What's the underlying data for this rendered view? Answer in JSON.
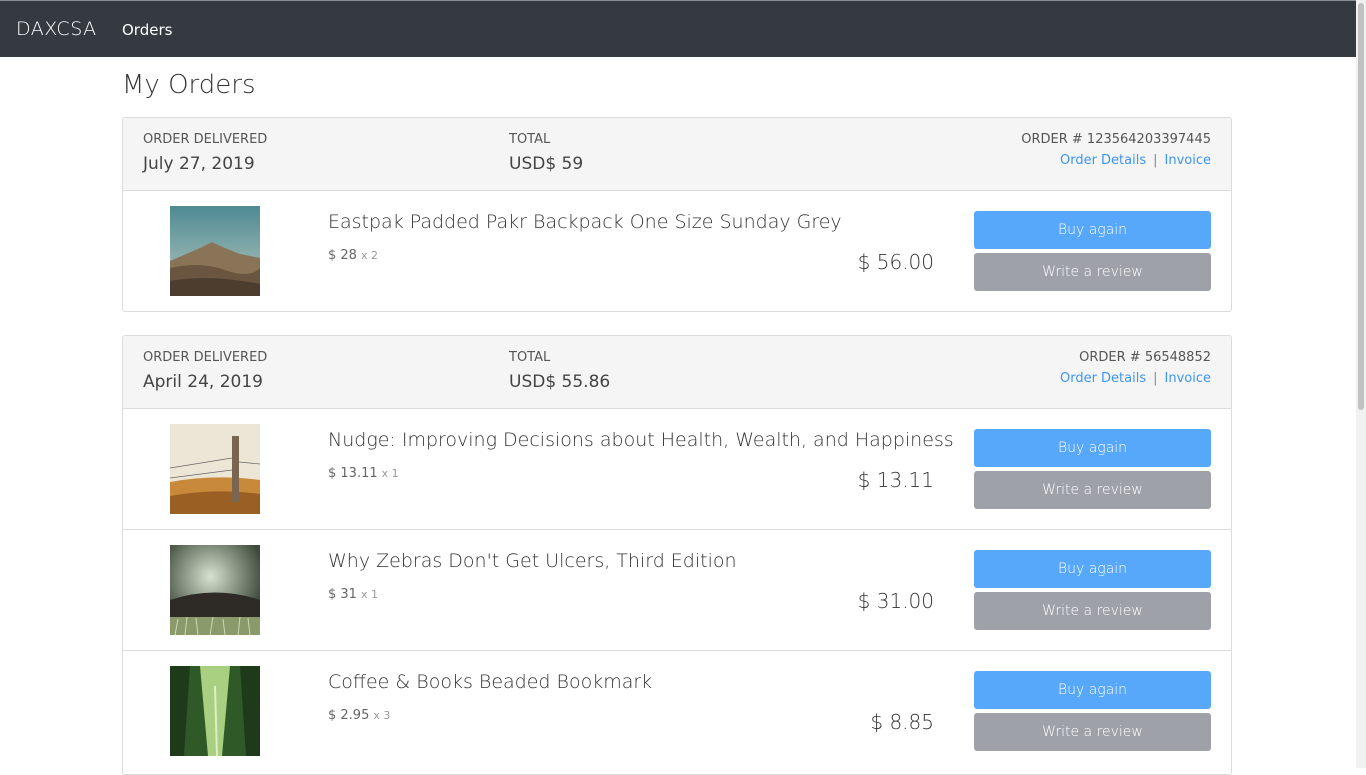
{
  "navbar": {
    "brand": "DAXCSA",
    "link": "Orders"
  },
  "page": {
    "title": "My Orders"
  },
  "labels": {
    "delivered": "ORDER DELIVERED",
    "total": "TOTAL",
    "order_details": "Order Details",
    "invoice": "Invoice",
    "separator": "|",
    "buy_again": "Buy again",
    "write_review": "Write a review"
  },
  "orders": [
    {
      "delivered_date": "July 27, 2019",
      "total": "USD$ 59",
      "order_number": "ORDER # 123564203397445",
      "items": [
        {
          "title": "Eastpak Padded Pakr Backpack One Size Sunday Grey",
          "unit_price": "$ 28",
          "qty": "x 2",
          "line_total": "$ 56.00",
          "image_icon": "mountain-landscape"
        }
      ]
    },
    {
      "delivered_date": "April 24, 2019",
      "total": "USD$ 55.86",
      "order_number": "ORDER # 56548852",
      "items": [
        {
          "title": "Nudge: Improving Decisions about Health, Wealth, and Happiness",
          "unit_price": "$ 13.11",
          "qty": "x 1",
          "line_total": "$ 13.11",
          "image_icon": "fence-post-field"
        },
        {
          "title": "Why Zebras Don't Get Ulcers, Third Edition",
          "unit_price": "$ 31",
          "qty": "x 1",
          "line_total": "$ 31.00",
          "image_icon": "grass-forest"
        },
        {
          "title": "Coffee & Books Beaded Bookmark",
          "unit_price": "$ 2.95",
          "qty": "x 3",
          "line_total": "$ 8.85",
          "image_icon": "bamboo-forest"
        }
      ]
    }
  ],
  "colors": {
    "navbar": "#343a40",
    "link": "#3d95f0",
    "buy": "#57a7fb",
    "review": "#9ea2a8"
  }
}
